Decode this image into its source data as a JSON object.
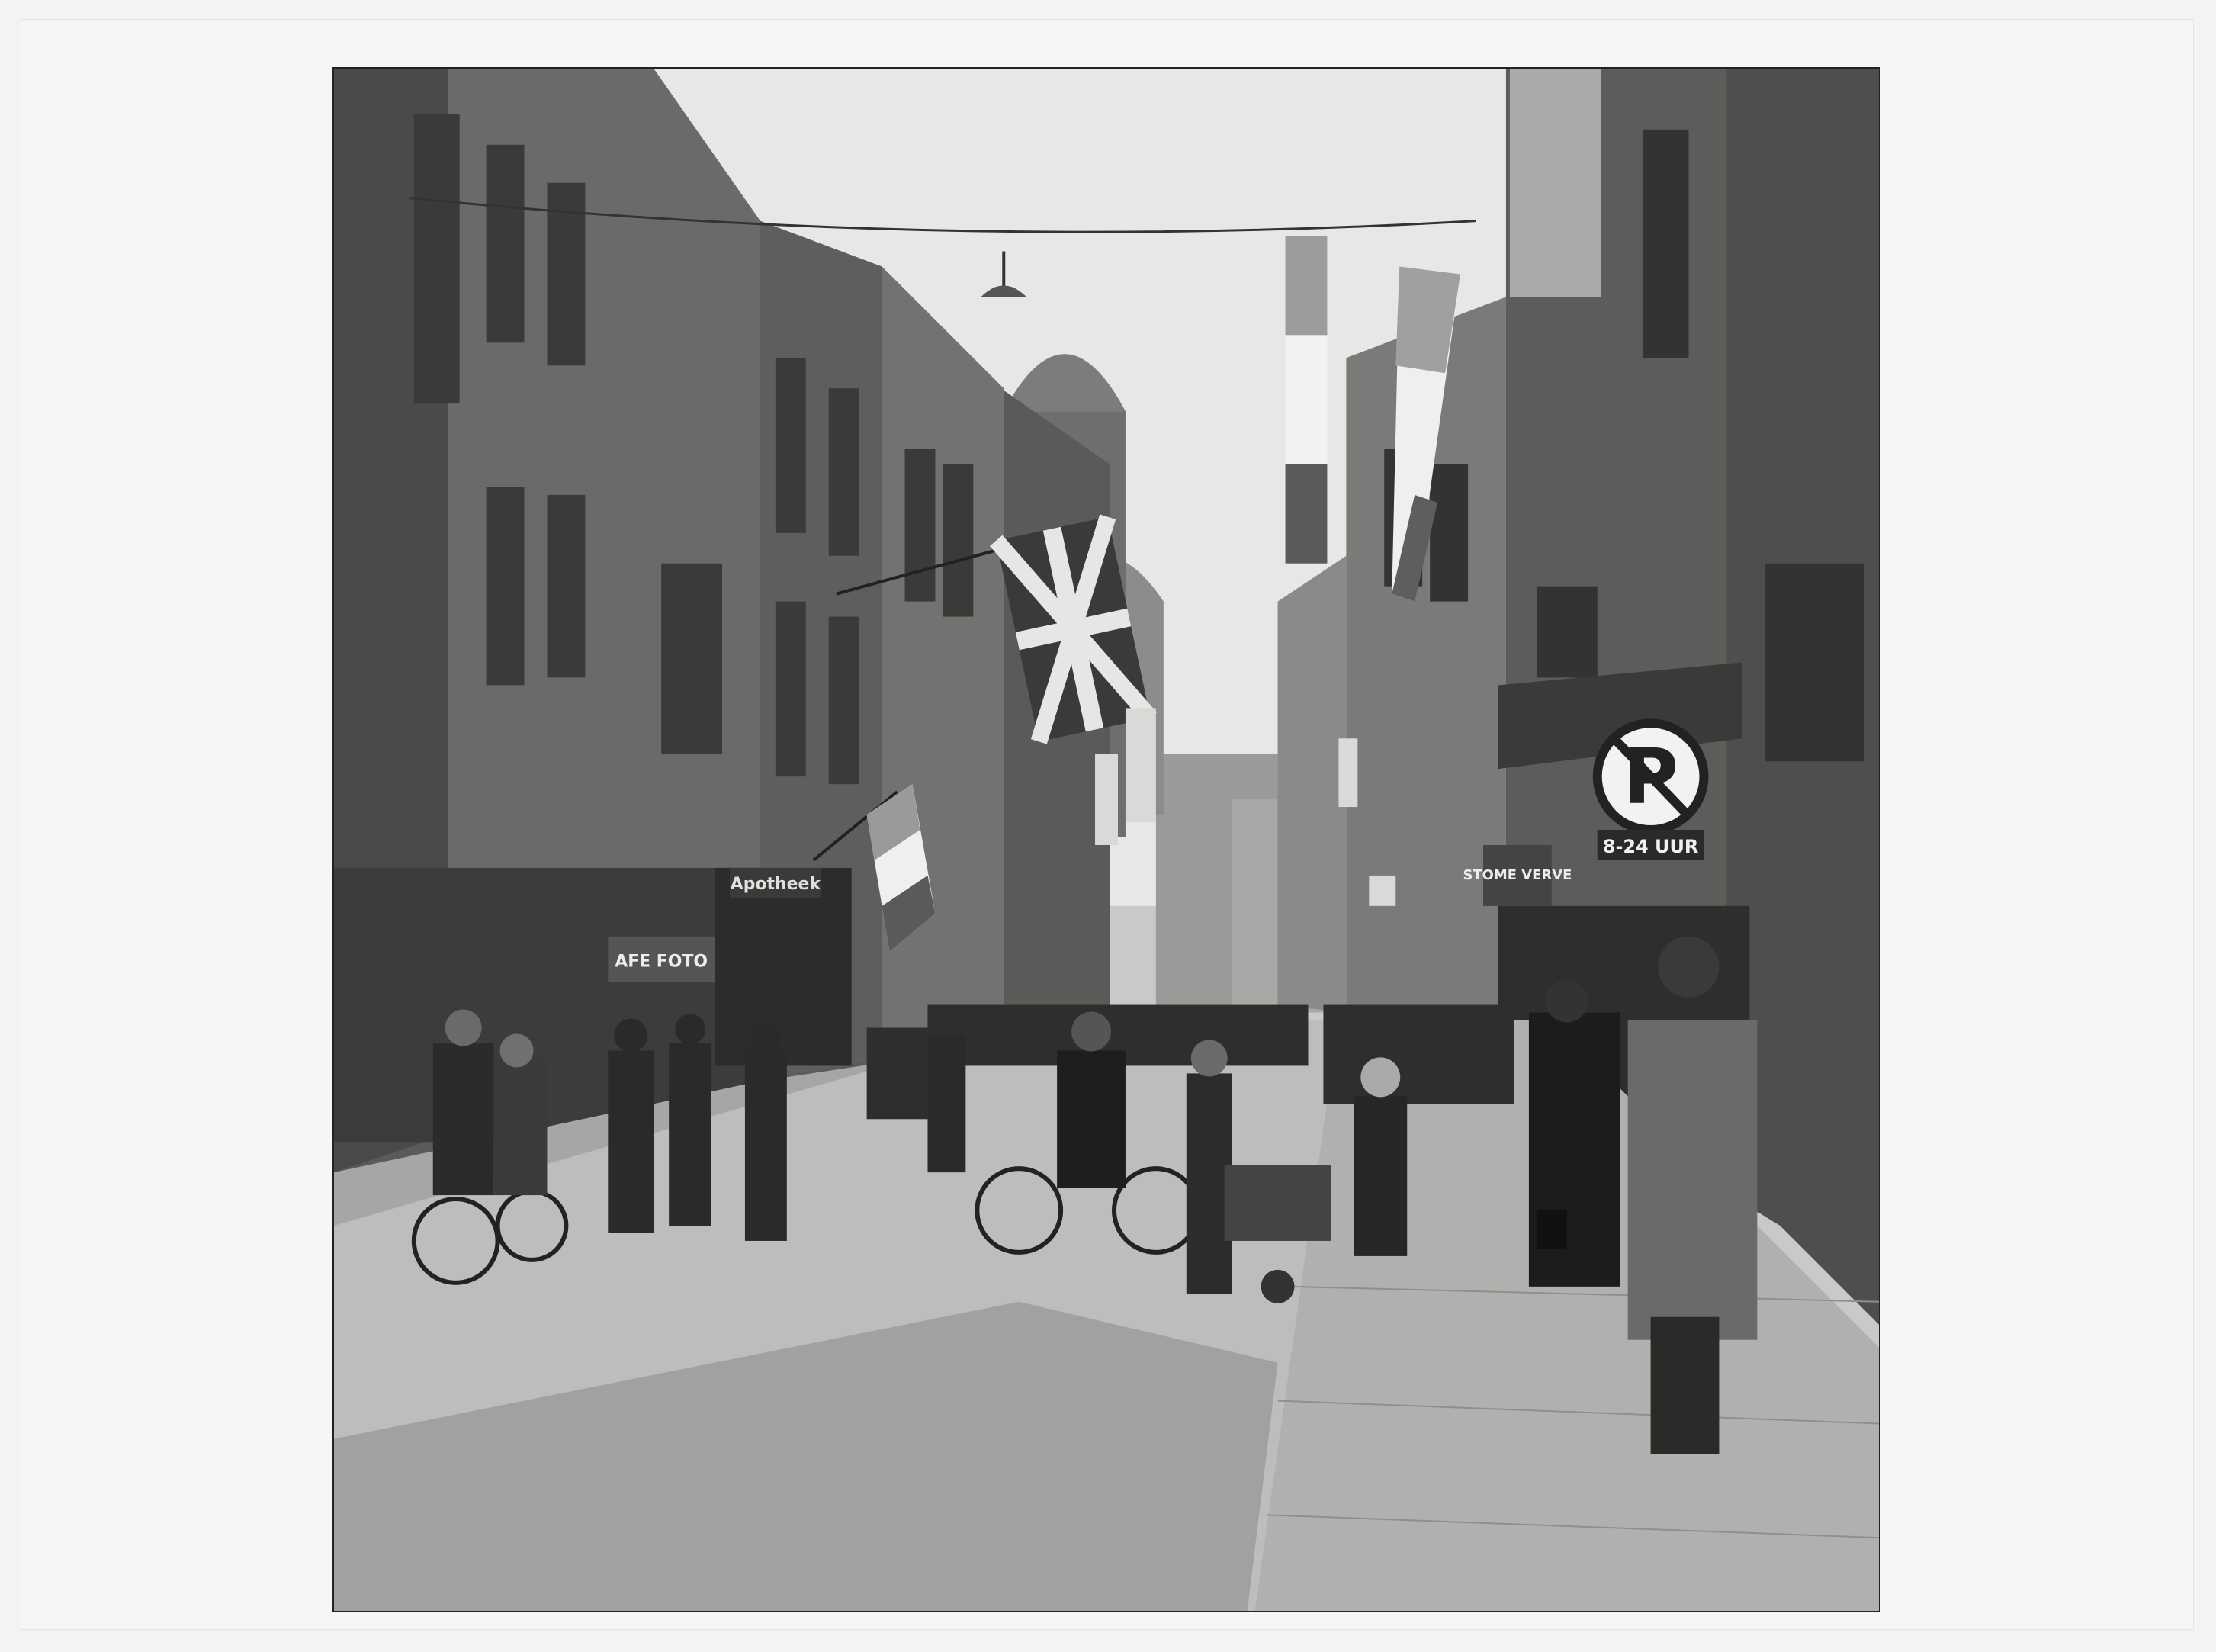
{
  "photo": {
    "signs": {
      "parking_letter": "P",
      "parking_hours": "8-24 UUR",
      "apotheek": "Apotheek",
      "foto": "AFE FOTO",
      "stomerij": "STOME VERVE"
    }
  },
  "colors": {
    "mount": "#f6f6f5",
    "sky": "#e8e8e6",
    "road": "#bdbdbb",
    "shadow": "#8e8e8c",
    "building_dark": "#4a4a48",
    "building_mid": "#7a7a78"
  }
}
